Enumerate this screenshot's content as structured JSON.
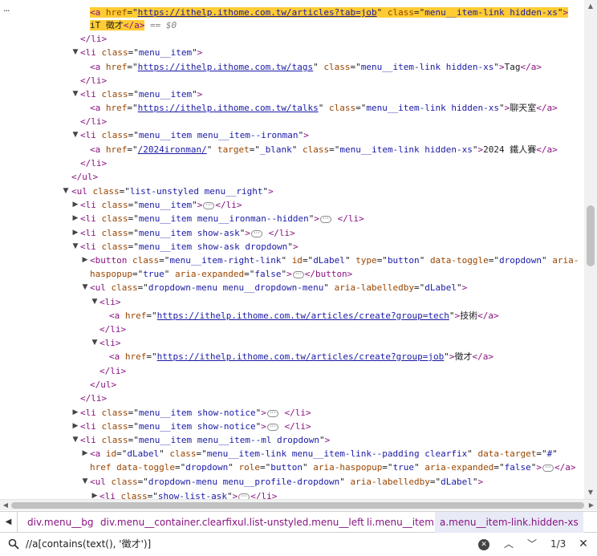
{
  "colors": {
    "tag": "#881280",
    "attr": "#994500",
    "value": "#1a1aa6",
    "highlight": "#ffcc33",
    "scrollbar_thumb": "#c1c1c1"
  },
  "tree": {
    "row1_href": "https://ithelp.ithome.com.tw/articles?tab=job",
    "row1_class": "menu__item-link  hidden-xs",
    "row2_text": "iT 徵才",
    "row2_dollar": "== $0",
    "row5_href": "https://ithelp.ithome.com.tw/tags",
    "row5_class": "menu__item-link  hidden-xs",
    "row5_text": "Tag",
    "row8_href": "https://ithelp.ithome.com.tw/talks",
    "row8_class": "menu__item-link  hidden-xs",
    "row8_text": "聊天室",
    "row10_class": "menu__item menu__item--ironman",
    "row11_href": "/2024ironman/",
    "row11_target": "_blank",
    "row11_class": "menu__item-link hidden-xs",
    "row11_text": "2024 鐵人賽",
    "row14_class": "list-unstyled menu__right",
    "row15_class": "menu__item",
    "row16_class": "menu__item menu__ironman--hidden",
    "row17_class": "menu__item show-ask",
    "row18_class": "menu__item show-ask dropdown",
    "row19_class": "menu__item-right-link",
    "row19_id": "dLabel",
    "row19_type": "button",
    "row19_toggle": "dropdown",
    "row19_aria_part": "aria-",
    "row20_haspopup_attr": "haspopup",
    "row20_haspopup": "true",
    "row20_expanded": "false",
    "row21_class": "dropdown-menu menu__dropdown-menu",
    "row21_labelledby": "dLabel",
    "row23_href": "https://ithelp.ithome.com.tw/articles/create?group=tech",
    "row23_text": "技術",
    "row26_href": "https://ithelp.ithome.com.tw/articles/create?group=job",
    "row26_text": "徵才",
    "row30_class": "menu__item show-notice",
    "row31_class": "menu__item show-notice",
    "row32_class": "menu__item menu__item--ml dropdown",
    "row33_id": "dLabel",
    "row33_class": "menu__item-link menu__item-link--padding clearfix",
    "row33_target": "#",
    "row34_toggle": "dropdown",
    "row34_role": "button",
    "row34_haspopup": "true",
    "row34_expanded": "false",
    "row35_class": "dropdown-menu menu__profile-dropdown",
    "row35_labelledby": "dLabel",
    "row36_class": "show-list-ask"
  },
  "breadcrumbs": [
    "div.menu__bg",
    "div.menu__container.clearfix",
    "ul.list-unstyled.menu__left",
    "li.menu__item",
    "a.menu__item-link.hidden-xs"
  ],
  "search": {
    "query": "//a[contains(text(), '徵才')]",
    "count": "1/3"
  }
}
